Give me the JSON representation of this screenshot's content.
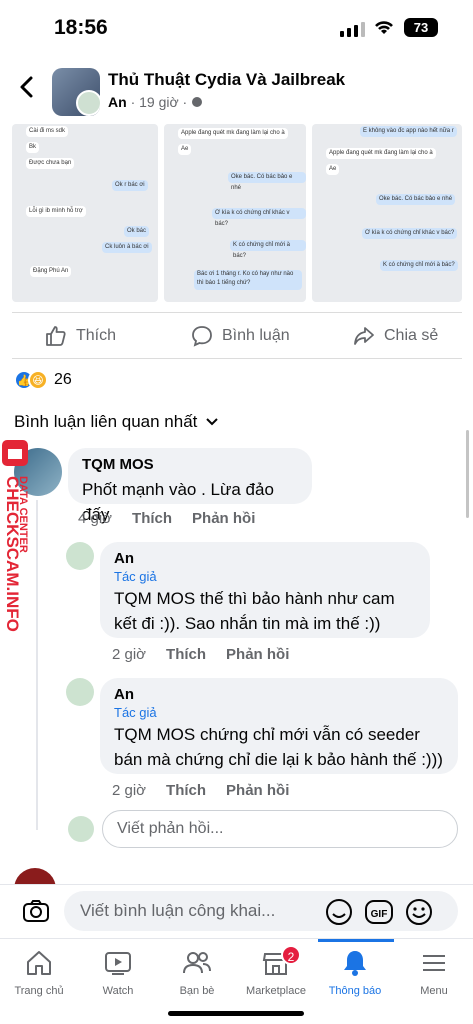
{
  "status": {
    "time": "18:56",
    "battery": "73"
  },
  "header": {
    "group_name": "Thủ Thuật Cydia Và Jailbreak",
    "author": "An",
    "time": "· 19 giờ ·"
  },
  "actions": {
    "like": "Thích",
    "comment": "Bình luận",
    "share": "Chia sẻ"
  },
  "reactions": {
    "count": "26"
  },
  "sort_label": "Bình luận liên quan nhất",
  "screenshots": [
    {
      "lines": [
        "Cài đi ms sdk",
        "Bk",
        "Được chưa bạn",
        "Ok r bác ơi",
        "Lỗi gì ib mình hỗ trợ",
        "Ok bác",
        "Ck luôn à bác ơi",
        "Đặng Phú An"
      ]
    },
    {
      "lines": [
        "Apple đang quét mk đang làm lại cho à",
        "Ae",
        "Oke bác. Có bác bảo e nhé",
        "Ơ kìa k có chứng chỉ khác v bác?",
        "K có chứng chỉ mới à bác?",
        "Bác ơi 1 tháng r. Ko có hay như nào thì báo 1 tiếng chứ?"
      ]
    },
    {
      "lines": [
        "E không vào đc app nào hết nữa r",
        "Apple đang quét mk đang làm lại cho à",
        "Ae",
        "Oke bác. Có bác bảo e nhé",
        "Ơ kìa k có chứng chỉ khác v bác?",
        "K có chứng chỉ mới à bác?"
      ]
    }
  ],
  "comments": [
    {
      "name": "TQM MOS",
      "text": "Phốt mạnh vào . Lừa đảo đấy",
      "time": "4 giờ",
      "like": "Thích",
      "reply": "Phản hồi"
    },
    {
      "name": "An",
      "tag": "Tác giả",
      "text": "TQM MOS thế thì bảo hành như cam kết đi :)). Sao nhắn tin mà im thế :))",
      "time": "2 giờ",
      "like": "Thích",
      "reply": "Phản hồi"
    },
    {
      "name": "An",
      "tag": "Tác giả",
      "text": "TQM MOS chứng chỉ mới vẫn có seeder bán mà chứng chỉ die lại k bảo hành thế :)))",
      "time": "2 giờ",
      "like": "Thích",
      "reply": "Phản hồi"
    }
  ],
  "reply_placeholder": "Viết phản hồi...",
  "composer_placeholder": "Viết bình luận công khai...",
  "watermark": {
    "line1": "DATA CENTER",
    "line2": "CHECKSCAM.INFO"
  },
  "tabs": [
    {
      "label": "Trang chủ"
    },
    {
      "label": "Watch"
    },
    {
      "label": "Bạn bè"
    },
    {
      "label": "Marketplace",
      "badge": "2"
    },
    {
      "label": "Thông báo"
    },
    {
      "label": "Menu"
    }
  ]
}
